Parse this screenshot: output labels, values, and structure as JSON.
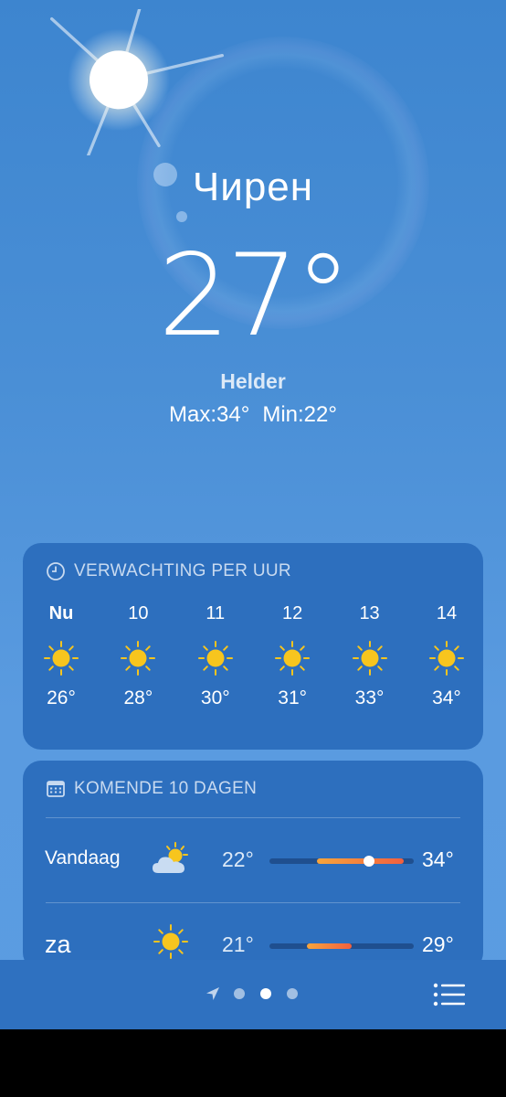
{
  "location": {
    "city": "Чирен"
  },
  "current": {
    "temperature": "27°",
    "condition": "Helder",
    "max": "Max:34°",
    "min": "Min:22°"
  },
  "hourly": {
    "header": "VERWACHTING PER UUR",
    "header_icon": "clock-icon",
    "items": [
      {
        "time": "Nu",
        "icon": "sun-icon",
        "temp": "26°"
      },
      {
        "time": "10",
        "icon": "sun-icon",
        "temp": "28°"
      },
      {
        "time": "11",
        "icon": "sun-icon",
        "temp": "30°"
      },
      {
        "time": "12",
        "icon": "sun-icon",
        "temp": "31°"
      },
      {
        "time": "13",
        "icon": "sun-icon",
        "temp": "33°"
      },
      {
        "time": "14",
        "icon": "sun-icon",
        "temp": "34°"
      }
    ]
  },
  "daily": {
    "header": "KOMENDE 10 DAGEN",
    "header_icon": "calendar-icon",
    "range_min": 21,
    "range_max": 35,
    "days": [
      {
        "name": "Vandaag",
        "icon": "partly-cloudy-icon",
        "low": "22°",
        "high": "34°",
        "low_value": 22,
        "high_value": 34,
        "current_value": 27
      },
      {
        "name": "za",
        "icon": "sun-icon",
        "low": "21°",
        "high": "29°",
        "low_value": 21,
        "high_value": 29
      }
    ]
  },
  "bottom": {
    "pages": 3,
    "active_page": 1,
    "icons": [
      "location-arrow-icon",
      "list-icon"
    ]
  },
  "colors": {
    "card": "#2d6fbe",
    "sun": "#f7c51e",
    "bar_warm": "#f7a53c",
    "bar_hot": "#f2603f"
  }
}
